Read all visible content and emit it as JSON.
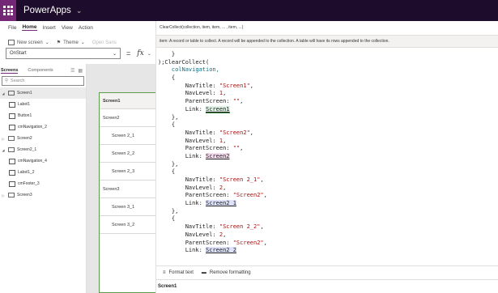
{
  "app": {
    "title": "PowerApps"
  },
  "menu": {
    "tabs": [
      {
        "label": "File",
        "active": false
      },
      {
        "label": "Home",
        "active": true
      },
      {
        "label": "Insert",
        "active": false
      },
      {
        "label": "View",
        "active": false
      },
      {
        "label": "Action",
        "active": false
      }
    ]
  },
  "toolbar": {
    "new_screen": "New screen",
    "theme": "Theme",
    "font": "Open Sans"
  },
  "formula_bar": {
    "property": "OnStart",
    "equals": "=",
    "fx": "fx"
  },
  "tree_view": {
    "tabs": {
      "screens": "Screens",
      "components": "Components"
    },
    "search_placeholder": "Search",
    "items": [
      {
        "label": "Screen1",
        "type": "screen",
        "level": 0,
        "expanded": true
      },
      {
        "label": "Label1",
        "type": "label",
        "level": 1
      },
      {
        "label": "Button1",
        "type": "button",
        "level": 1
      },
      {
        "label": "cmNavigation_2",
        "type": "component",
        "level": 1
      },
      {
        "label": "Screen2",
        "type": "screen",
        "level": 0,
        "expanded": false
      },
      {
        "label": "Screen2_1",
        "type": "screen",
        "level": 0,
        "expanded": true
      },
      {
        "label": "cmNavigation_4",
        "type": "component",
        "level": 1
      },
      {
        "label": "Label1_2",
        "type": "label",
        "level": 1
      },
      {
        "label": "cmFooter_3",
        "type": "component",
        "level": 1
      },
      {
        "label": "Screen3",
        "type": "screen",
        "level": 0,
        "expanded": false
      }
    ]
  },
  "canvas": {
    "nav_items": [
      {
        "label": "Screen1",
        "level": "header"
      },
      {
        "label": "Screen2",
        "level": "lvl1"
      },
      {
        "label": "Screen 2_1",
        "level": "lvl2"
      },
      {
        "label": "Screen 2_2",
        "level": "lvl2"
      },
      {
        "label": "Screen 2_3",
        "level": "lvl2"
      },
      {
        "label": "Screen3",
        "level": "lvl1"
      },
      {
        "label": "Screen 3_1",
        "level": "lvl2"
      },
      {
        "label": "Screen 3_2",
        "level": "lvl2"
      }
    ]
  },
  "editor": {
    "signature": "ClearCollect(collection, item, item, ... , item, ...)",
    "tip": "item: A record or table to collect. A record will be appended to the collection. A table will have its rows appended to the collection.",
    "code_lines": [
      [
        {
          "t": "    }",
          "c": ""
        }
      ],
      [
        {
          "t": ");ClearCollect(",
          "c": ""
        }
      ],
      [
        {
          "t": "    colNavigation,",
          "c": "kw"
        }
      ],
      [
        {
          "t": "    {",
          "c": ""
        }
      ],
      [
        {
          "t": "        NavTitle: ",
          "c": ""
        },
        {
          "t": "\"Screen1\"",
          "c": "str"
        },
        {
          "t": ",",
          "c": ""
        }
      ],
      [
        {
          "t": "        NavLevel: ",
          "c": ""
        },
        {
          "t": "1",
          "c": "num"
        },
        {
          "t": ",",
          "c": ""
        }
      ],
      [
        {
          "t": "        ParentScreen: ",
          "c": ""
        },
        {
          "t": "\"\"",
          "c": "str"
        },
        {
          "t": ",",
          "c": ""
        }
      ],
      [
        {
          "t": "        Link: ",
          "c": ""
        },
        {
          "t": "Screen1",
          "c": "ref green"
        }
      ],
      [
        {
          "t": "    },",
          "c": ""
        }
      ],
      [
        {
          "t": "    {",
          "c": ""
        }
      ],
      [
        {
          "t": "        NavTitle: ",
          "c": ""
        },
        {
          "t": "\"Screen2\"",
          "c": "str"
        },
        {
          "t": ",",
          "c": ""
        }
      ],
      [
        {
          "t": "        NavLevel: ",
          "c": ""
        },
        {
          "t": "1",
          "c": "num"
        },
        {
          "t": ",",
          "c": ""
        }
      ],
      [
        {
          "t": "        ParentScreen: ",
          "c": ""
        },
        {
          "t": "\"\"",
          "c": "str"
        },
        {
          "t": ",",
          "c": ""
        }
      ],
      [
        {
          "t": "        Link: ",
          "c": ""
        },
        {
          "t": "Screen2",
          "c": "ref pink"
        }
      ],
      [
        {
          "t": "    },",
          "c": ""
        }
      ],
      [
        {
          "t": "    {",
          "c": ""
        }
      ],
      [
        {
          "t": "        NavTitle: ",
          "c": ""
        },
        {
          "t": "\"Screen 2_1\"",
          "c": "str"
        },
        {
          "t": ",",
          "c": ""
        }
      ],
      [
        {
          "t": "        NavLevel: ",
          "c": ""
        },
        {
          "t": "2",
          "c": "num"
        },
        {
          "t": ",",
          "c": ""
        }
      ],
      [
        {
          "t": "        ParentScreen: ",
          "c": ""
        },
        {
          "t": "\"Screen2\"",
          "c": "str"
        },
        {
          "t": ",",
          "c": ""
        }
      ],
      [
        {
          "t": "        Link: ",
          "c": ""
        },
        {
          "t": "Screen2_1",
          "c": "ref blue"
        }
      ],
      [
        {
          "t": "    },",
          "c": ""
        }
      ],
      [
        {
          "t": "    {",
          "c": ""
        }
      ],
      [
        {
          "t": "        NavTitle: ",
          "c": ""
        },
        {
          "t": "\"Screen 2_2\"",
          "c": "str"
        },
        {
          "t": ",",
          "c": ""
        }
      ],
      [
        {
          "t": "        NavLevel: ",
          "c": ""
        },
        {
          "t": "2",
          "c": "num"
        },
        {
          "t": ",",
          "c": ""
        }
      ],
      [
        {
          "t": "        ParentScreen: ",
          "c": ""
        },
        {
          "t": "\"Screen2\"",
          "c": "str"
        },
        {
          "t": ",",
          "c": ""
        }
      ],
      [
        {
          "t": "        Link: ",
          "c": ""
        },
        {
          "t": "Screen2_2",
          "c": "ref blue"
        }
      ]
    ],
    "format_text": "Format text",
    "remove_formatting": "Remove formatting",
    "status": "Screen1"
  },
  "colors": {
    "brand": "#742774",
    "topbar": "#1e0c2c"
  }
}
